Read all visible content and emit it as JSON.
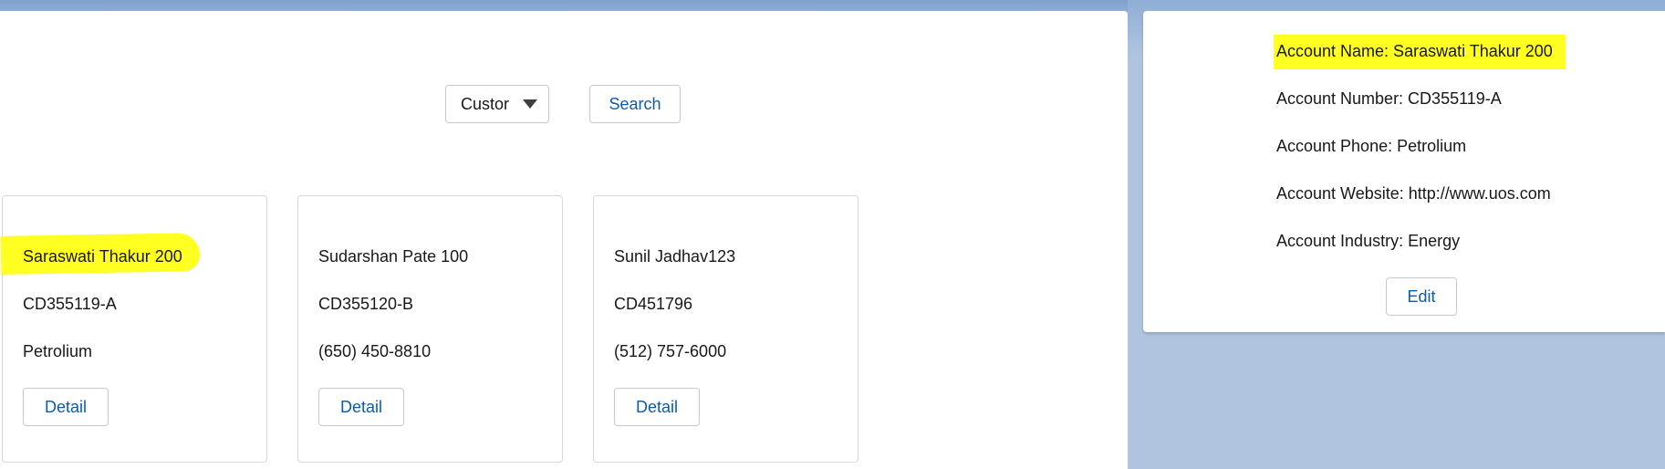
{
  "search": {
    "select_value": "Custor",
    "search_label": "Search"
  },
  "cards": [
    {
      "name": "Saraswati Thakur 200",
      "number": "CD355119-A",
      "phone": "Petrolium",
      "detail_label": "Detail",
      "highlighted": true
    },
    {
      "name": "Sudarshan Pate 100",
      "number": "CD355120-B",
      "phone": "(650) 450-8810",
      "detail_label": "Detail",
      "highlighted": false
    },
    {
      "name": "Sunil Jadhav123",
      "number": "CD451796",
      "phone": "(512) 757-6000",
      "detail_label": "Detail",
      "highlighted": false
    }
  ],
  "detail": {
    "name": "Account Name: Saraswati Thakur 200",
    "number": "Account Number: CD355119-A",
    "phone": "Account Phone: Petrolium",
    "website": "Account Website: http://www.uos.com",
    "industry": "Account Industry: Energy",
    "edit_label": "Edit"
  },
  "colors": {
    "highlight": "#ffff22",
    "link_blue": "#0b5cab",
    "background": "#b0c4df"
  }
}
